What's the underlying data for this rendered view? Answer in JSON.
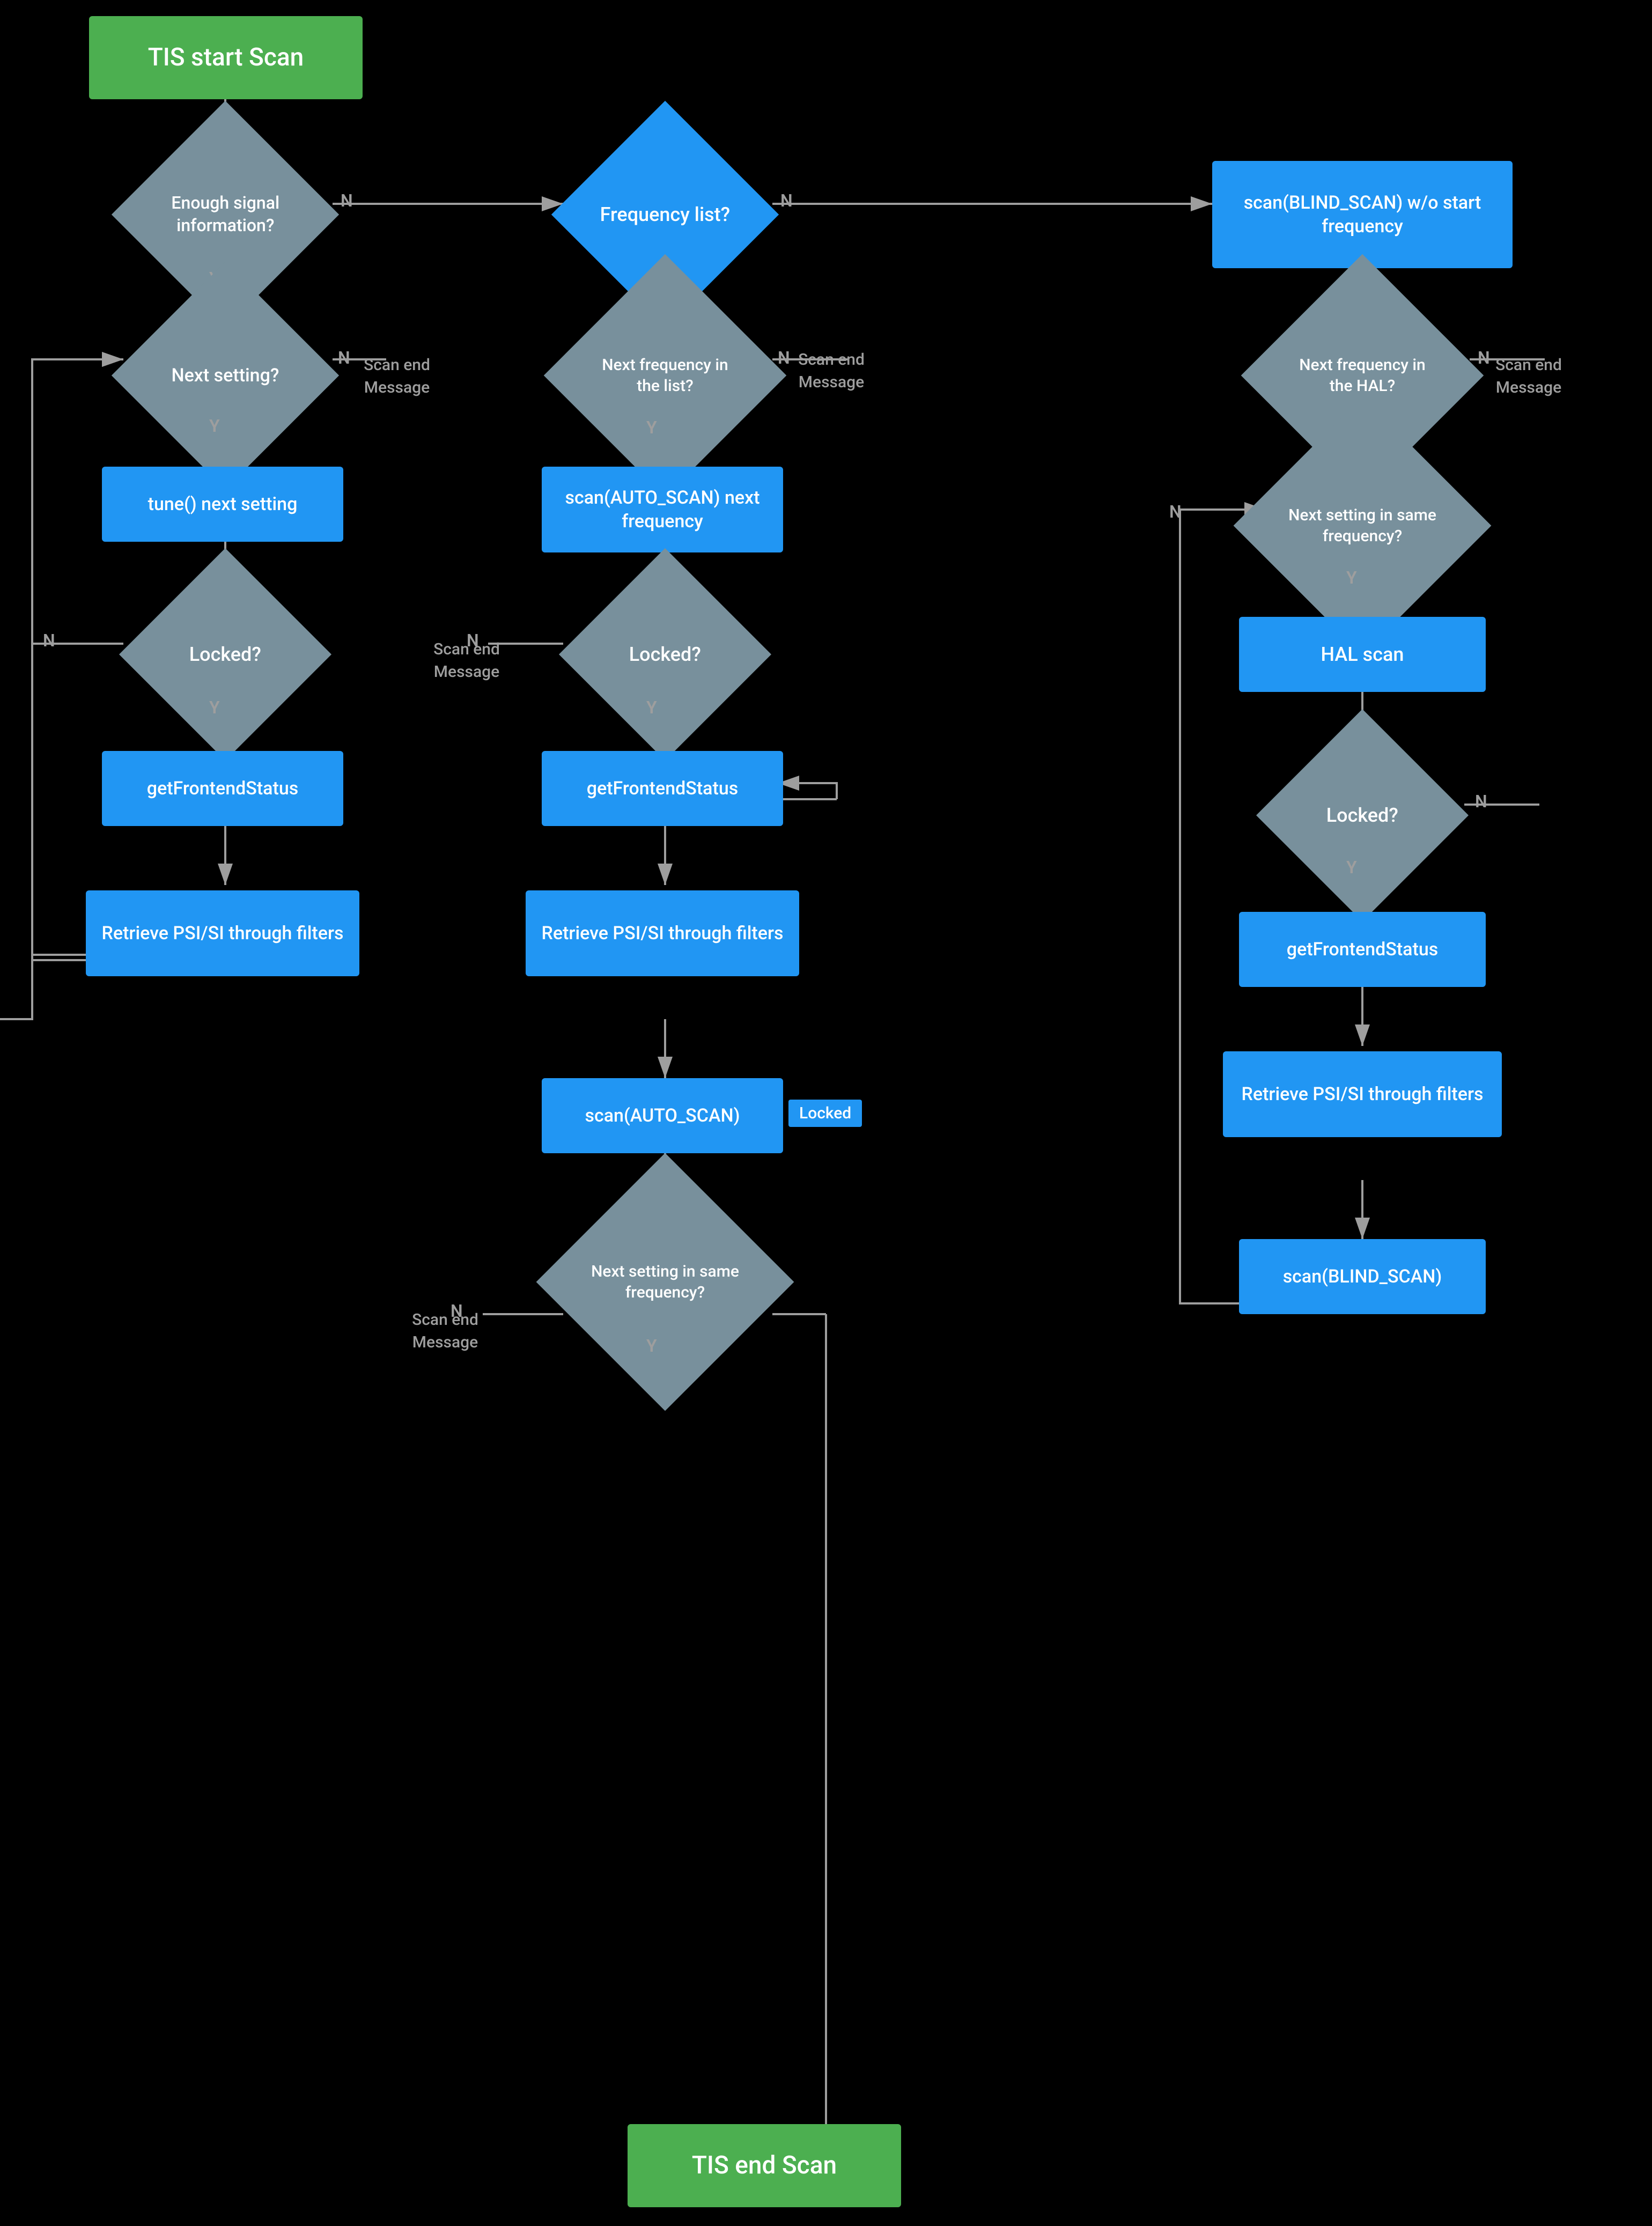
{
  "nodes": {
    "start": {
      "label": "TIS start Scan"
    },
    "end": {
      "label": "TIS end Scan"
    },
    "enough_signal": {
      "label": "Enough signal\ninformation?"
    },
    "frequency_list": {
      "label": "Frequency\nlist?"
    },
    "blind_scan_no_start": {
      "label": "scan(BLIND_SCAN)\nw/o start frequency"
    },
    "next_setting": {
      "label": "Next setting?"
    },
    "tune_next": {
      "label": "tune() next setting"
    },
    "locked1": {
      "label": "Locked?"
    },
    "get_frontend1": {
      "label": "getFrontendStatus"
    },
    "retrieve_psi1": {
      "label": "Retrieve PSI/SI\nthrough filters"
    },
    "next_freq_list": {
      "label": "Next frequency\nin the list?"
    },
    "scan_auto": {
      "label": "scan(AUTO_SCAN)\nnext frequency"
    },
    "locked2": {
      "label": "Locked?"
    },
    "get_frontend2": {
      "label": "getFrontendStatus"
    },
    "retrieve_psi2": {
      "label": "Retrieve PSI/SI\nthrough filters"
    },
    "scan_auto2": {
      "label": "scan(AUTO_SCAN)"
    },
    "next_setting_same_freq": {
      "label": "Next setting in\nsame frequency?"
    },
    "next_freq_hal": {
      "label": "Next frequency\nin the HAL?"
    },
    "next_setting_same_freq2": {
      "label": "Next setting in\nsame frequency?"
    },
    "hal_scan": {
      "label": "HAL scan"
    },
    "locked3": {
      "label": "Locked?"
    },
    "get_frontend3": {
      "label": "getFrontendStatus"
    },
    "retrieve_psi3": {
      "label": "Retrieve PSI/SI\nthrough filters"
    },
    "scan_blind2": {
      "label": "scan(BLIND_SCAN)"
    }
  },
  "labels": {
    "n": "N",
    "y": "Y",
    "scan_end_message": "Scan end\nMessage",
    "locked_badge": "Locked"
  },
  "colors": {
    "bg": "#000000",
    "blue": "#2196F3",
    "green": "#4CAF50",
    "diamond": "#78909C",
    "text_muted": "#9E9E9E",
    "white": "#ffffff"
  }
}
